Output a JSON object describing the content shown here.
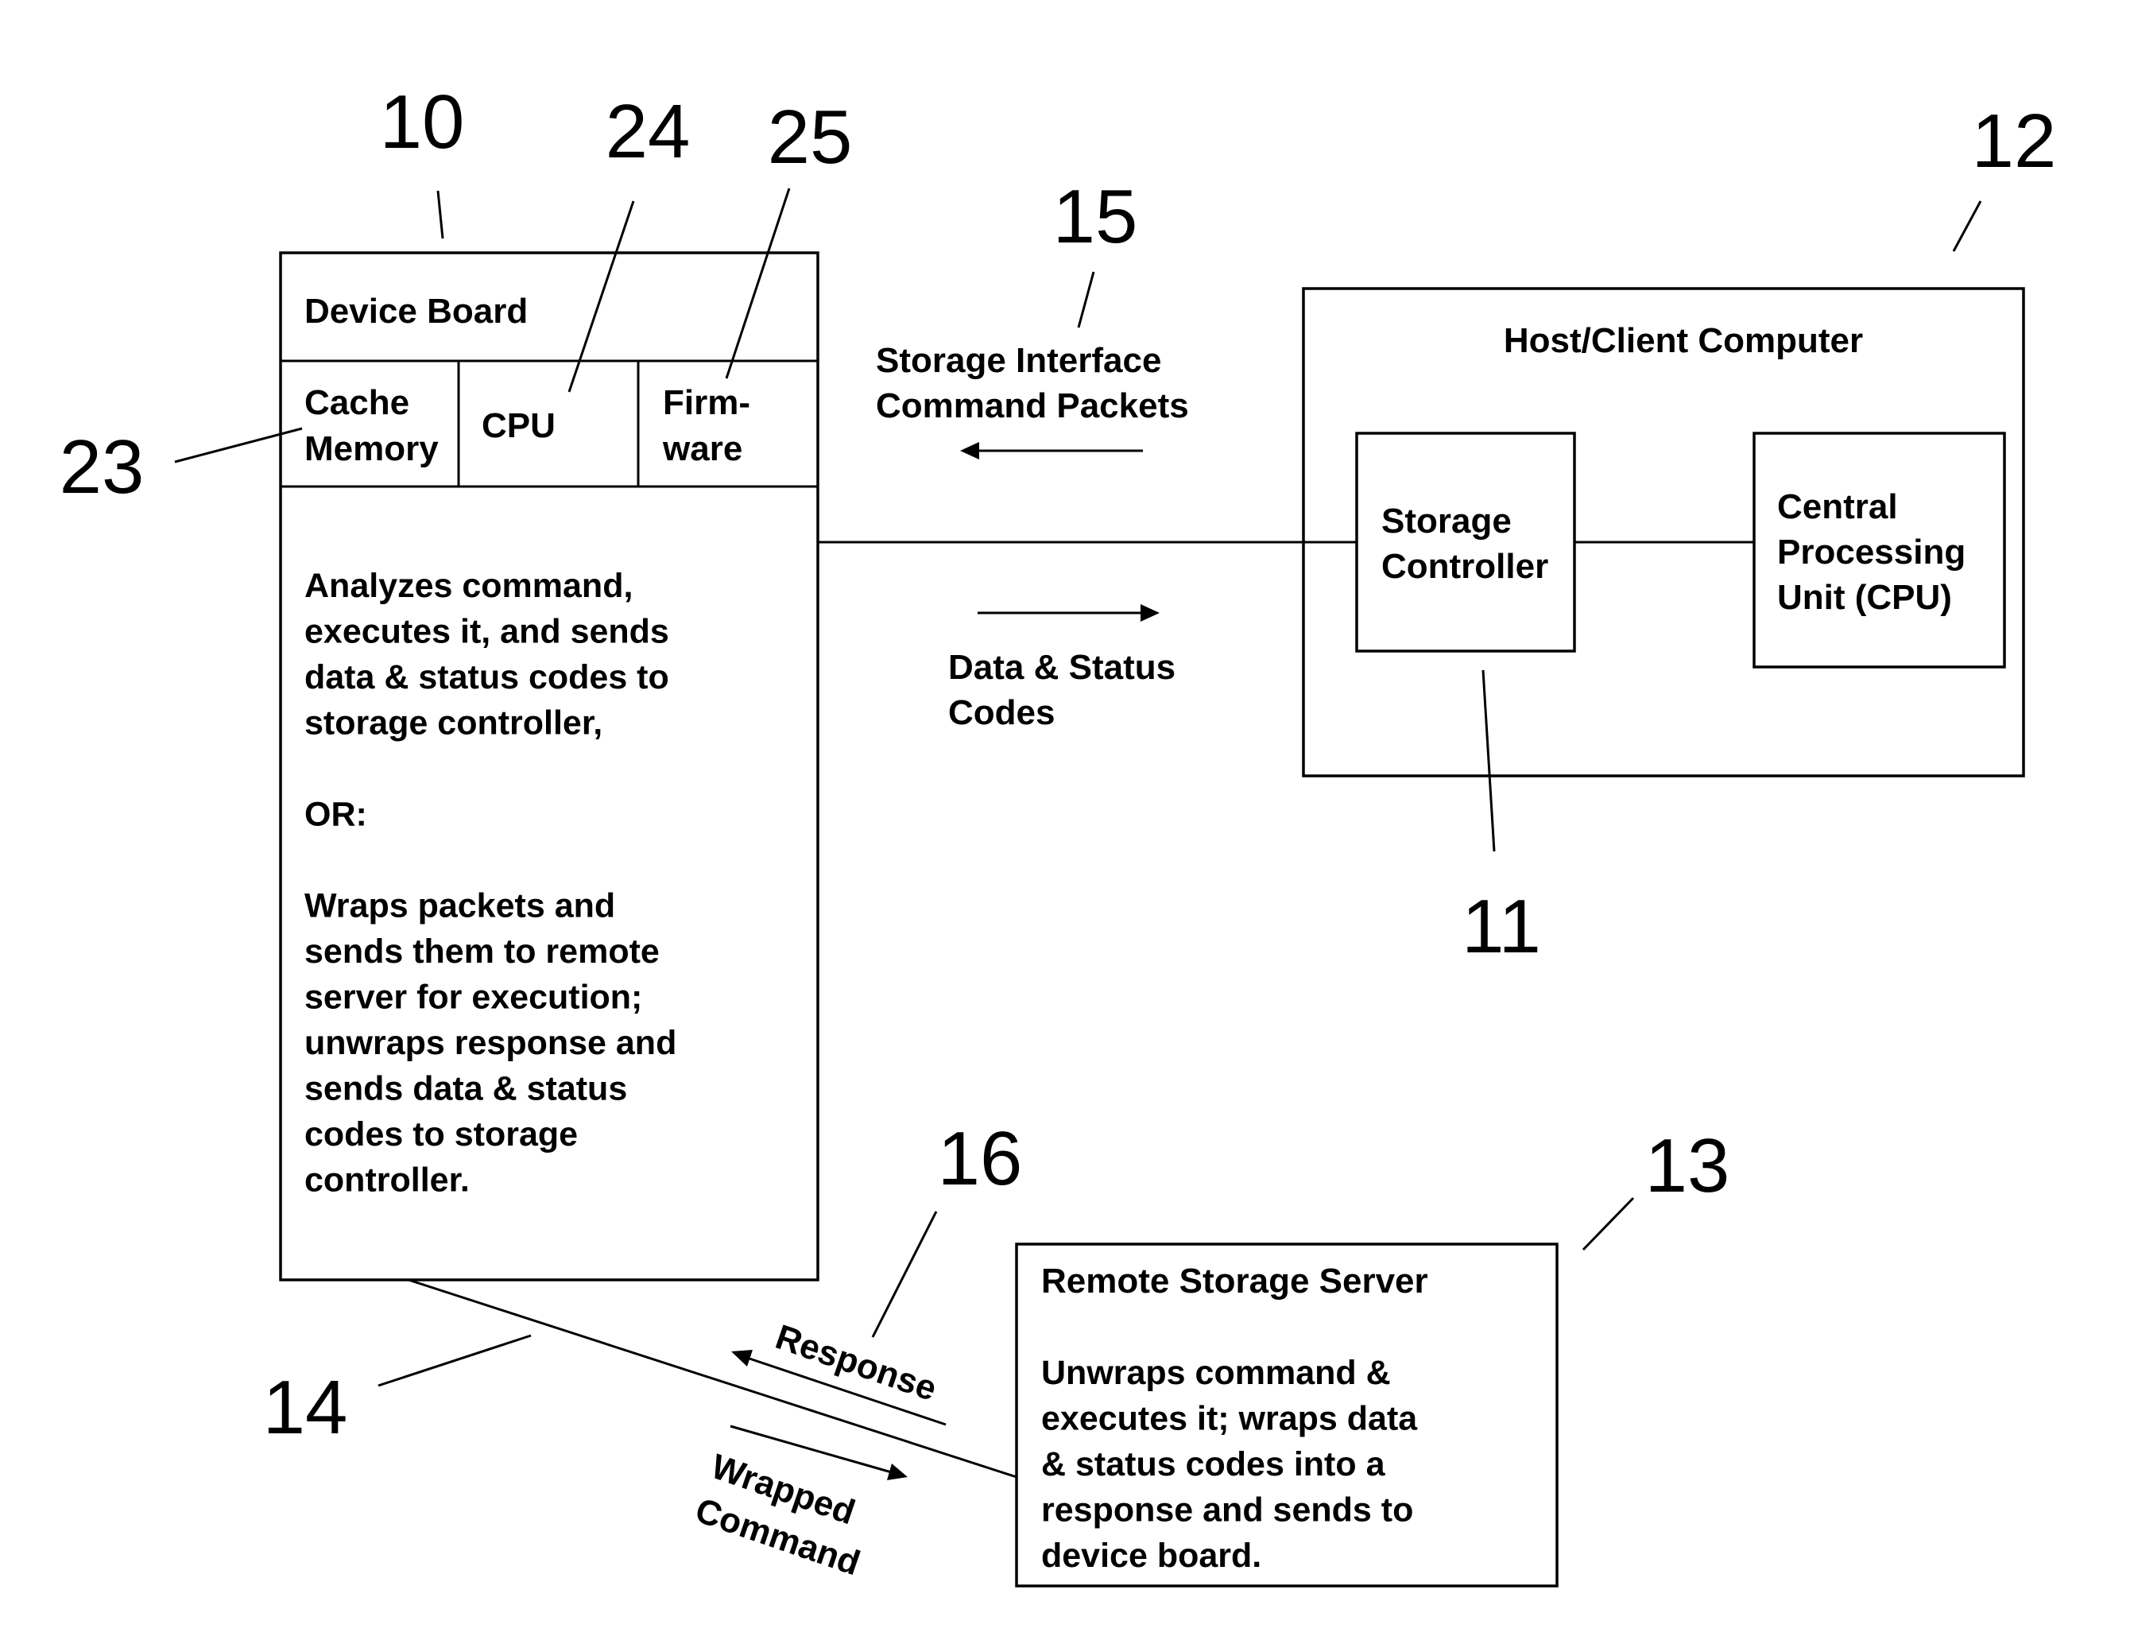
{
  "reference_numerals": {
    "device_board": "10",
    "storage_controller": "11",
    "host_computer": "12",
    "remote_server": "13",
    "link_to_remote": "14",
    "storage_interface": "15",
    "response_path": "16",
    "cache_memory": "23",
    "cpu": "24",
    "firmware": "25"
  },
  "device_board": {
    "title": "Device Board",
    "cells": {
      "cache_memory": [
        "Cache",
        "Memory"
      ],
      "cpu": [
        "CPU"
      ],
      "firmware": [
        "Firm-",
        "ware"
      ]
    },
    "description": [
      "Analyzes command,",
      "executes it, and sends",
      "data & status codes to",
      "storage controller,",
      "",
      "OR:",
      "",
      "Wraps packets and",
      "sends them to remote",
      "server for execution;",
      "unwraps response and",
      "sends data & status",
      "codes to storage",
      "controller."
    ]
  },
  "interface": {
    "command_label": [
      "Storage Interface",
      "Command Packets"
    ],
    "data_label": [
      "Data & Status",
      "Codes"
    ]
  },
  "host": {
    "title": "Host/Client Computer",
    "storage_controller": [
      "Storage",
      "Controller"
    ],
    "cpu": [
      "Central",
      "Processing",
      "Unit (CPU)"
    ]
  },
  "remote_server": {
    "title": "Remote Storage Server",
    "description": [
      "Unwraps command &",
      "executes it; wraps data",
      "& status codes into a",
      "response and sends to",
      "device board."
    ]
  },
  "network": {
    "response_label": "Response",
    "wrapped_label": [
      "Wrapped",
      "Command"
    ]
  }
}
